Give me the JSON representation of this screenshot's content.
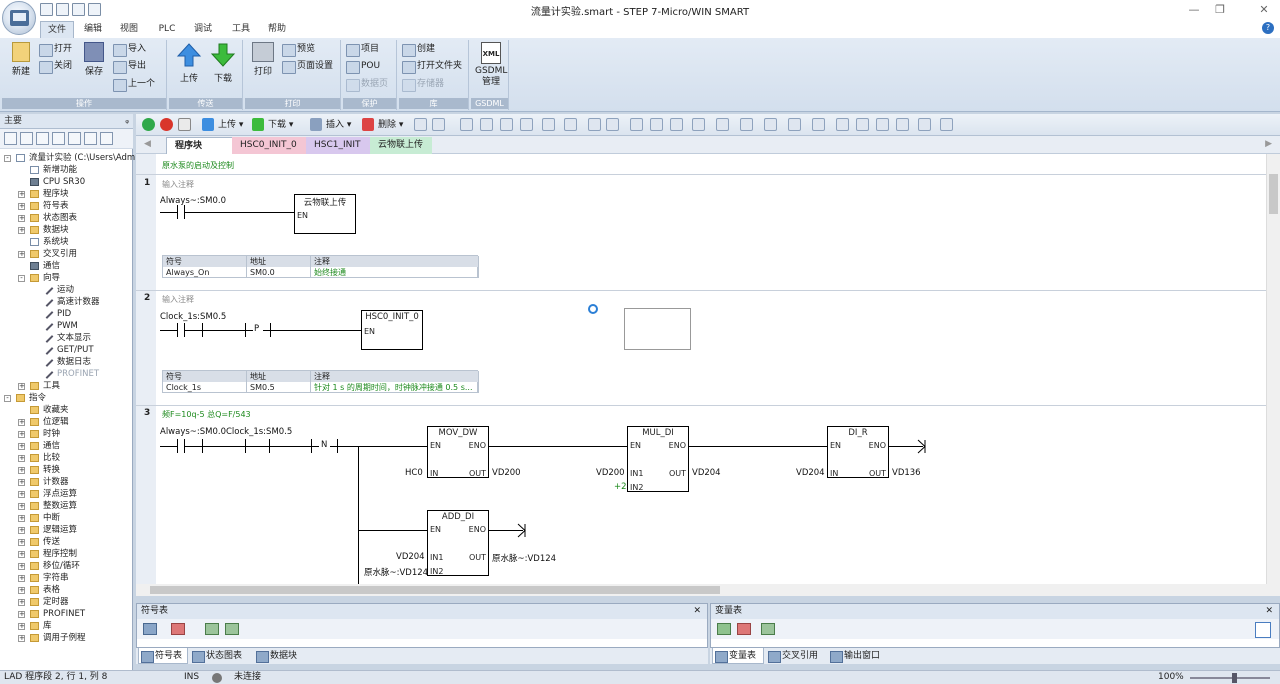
{
  "window": {
    "title": "流量计实验.smart - STEP 7-Micro/WIN SMART",
    "min": "—",
    "max": "❐",
    "close": "✕"
  },
  "ribbon_tabs": [
    "文件",
    "编辑",
    "视图",
    "PLC",
    "调试",
    "工具",
    "帮助"
  ],
  "ribbon": {
    "groups": {
      "ops": "操作",
      "transfer": "传送",
      "print": "打印",
      "protect": "保护",
      "lib": "库",
      "gsdml": "GSDML"
    },
    "new": "新建",
    "open": "打开",
    "close": "关闭",
    "save": "保存",
    "import": "导入",
    "export": "导出",
    "prev": "上一个",
    "upload": "上传",
    "download": "下载",
    "print": "打印",
    "preview": "预览",
    "page_setup": "页面设置",
    "project": "项目",
    "pou": "POU",
    "data_page": "数据页",
    "create": "创建",
    "open_folder": "打开文件夹",
    "memory": "存储器",
    "gsdml_mgmt": "GSDML\n管理",
    "xml": "XML"
  },
  "left_panel": {
    "title": "主要",
    "pin": "ᵩ",
    "tree": [
      {
        "label": "流量计实验 (C:\\Users\\Admi",
        "level": 0,
        "exp": "-",
        "icon": "page"
      },
      {
        "label": "新增功能",
        "level": 1,
        "icon": "page"
      },
      {
        "label": "CPU SR30",
        "level": 1,
        "icon": "cpu"
      },
      {
        "label": "程序块",
        "level": 1,
        "exp": "+",
        "icon": "folder"
      },
      {
        "label": "符号表",
        "level": 1,
        "exp": "+",
        "icon": "folder"
      },
      {
        "label": "状态图表",
        "level": 1,
        "exp": "+",
        "icon": "folder"
      },
      {
        "label": "数据块",
        "level": 1,
        "exp": "+",
        "icon": "folder"
      },
      {
        "label": "系统块",
        "level": 1,
        "icon": "page"
      },
      {
        "label": "交叉引用",
        "level": 1,
        "exp": "+",
        "icon": "folder"
      },
      {
        "label": "通信",
        "level": 1,
        "icon": "cpu"
      },
      {
        "label": "向导",
        "level": 1,
        "exp": "-",
        "icon": "folder"
      },
      {
        "label": "运动",
        "level": 2,
        "icon": "wand"
      },
      {
        "label": "高速计数器",
        "level": 2,
        "icon": "wand"
      },
      {
        "label": "PID",
        "level": 2,
        "icon": "wand"
      },
      {
        "label": "PWM",
        "level": 2,
        "icon": "wand"
      },
      {
        "label": "文本显示",
        "level": 2,
        "icon": "wand"
      },
      {
        "label": "GET/PUT",
        "level": 2,
        "icon": "wand"
      },
      {
        "label": "数据日志",
        "level": 2,
        "icon": "wand"
      },
      {
        "label": "PROFINET",
        "level": 2,
        "icon": "wand",
        "disabled": true
      },
      {
        "label": "工具",
        "level": 1,
        "exp": "+",
        "icon": "folder"
      },
      {
        "label": "指令",
        "level": 0,
        "exp": "-",
        "icon": "folder"
      },
      {
        "label": "收藏夹",
        "level": 1,
        "icon": "folder"
      },
      {
        "label": "位逻辑",
        "level": 1,
        "exp": "+",
        "icon": "folder"
      },
      {
        "label": "时钟",
        "level": 1,
        "exp": "+",
        "icon": "folder"
      },
      {
        "label": "通信",
        "level": 1,
        "exp": "+",
        "icon": "folder"
      },
      {
        "label": "比较",
        "level": 1,
        "exp": "+",
        "icon": "folder"
      },
      {
        "label": "转换",
        "level": 1,
        "exp": "+",
        "icon": "folder"
      },
      {
        "label": "计数器",
        "level": 1,
        "exp": "+",
        "icon": "folder"
      },
      {
        "label": "浮点运算",
        "level": 1,
        "exp": "+",
        "icon": "folder"
      },
      {
        "label": "整数运算",
        "level": 1,
        "exp": "+",
        "icon": "folder"
      },
      {
        "label": "中断",
        "level": 1,
        "exp": "+",
        "icon": "folder"
      },
      {
        "label": "逻辑运算",
        "level": 1,
        "exp": "+",
        "icon": "folder"
      },
      {
        "label": "传送",
        "level": 1,
        "exp": "+",
        "icon": "folder"
      },
      {
        "label": "程序控制",
        "level": 1,
        "exp": "+",
        "icon": "folder"
      },
      {
        "label": "移位/循环",
        "level": 1,
        "exp": "+",
        "icon": "folder"
      },
      {
        "label": "字符串",
        "level": 1,
        "exp": "+",
        "icon": "folder"
      },
      {
        "label": "表格",
        "level": 1,
        "exp": "+",
        "icon": "folder"
      },
      {
        "label": "定时器",
        "level": 1,
        "exp": "+",
        "icon": "folder"
      },
      {
        "label": "PROFINET",
        "level": 1,
        "exp": "+",
        "icon": "folder"
      },
      {
        "label": "库",
        "level": 1,
        "exp": "+",
        "icon": "folder"
      },
      {
        "label": "调用子例程",
        "level": 1,
        "exp": "+",
        "icon": "folder"
      }
    ]
  },
  "editor_toolbar": {
    "upload": "上传",
    "download": "下载",
    "insert": "插入",
    "delete": "删除"
  },
  "doc_tabs": [
    {
      "label": "程序块",
      "close": "×"
    },
    {
      "label": "HSC0_INIT_0"
    },
    {
      "label": "HSC1_INIT"
    },
    {
      "label": "云物联上传"
    }
  ],
  "program": {
    "header_comment": "原水泵的启动及控制",
    "networks": [
      {
        "num": "1",
        "comment": "输入注释",
        "contact": "Always~:SM0.0",
        "box": "云物联上传",
        "en": "EN",
        "symtab": {
          "hdr": [
            "符号",
            "地址",
            "注释"
          ],
          "row": [
            "Always_On",
            "SM0.0",
            "始终接通"
          ]
        }
      },
      {
        "num": "2",
        "comment": "输入注释",
        "contact": "Clock_1s:SM0.5",
        "p": "P",
        "box": "HSC0_INIT_0",
        "en": "EN",
        "symtab": {
          "hdr": [
            "符号",
            "地址",
            "注释"
          ],
          "row": [
            "Clock_1s",
            "SM0.5",
            "针对 1 s 的周期时间，时钟脉冲接通 0.5 s..."
          ]
        }
      },
      {
        "num": "3",
        "comment": "频F=10q-5       总Q=F/543",
        "contact1": "Always~:SM0.0",
        "contact2": "Clock_1s:SM0.5",
        "n": "N",
        "mov": {
          "title": "MOV_DW",
          "en": "EN",
          "eno": "ENO",
          "in": "IN",
          "out": "OUT",
          "in_val": "HC0",
          "out_val": "VD200"
        },
        "mul": {
          "title": "MUL_DI",
          "en": "EN",
          "eno": "ENO",
          "in1": "IN1",
          "in2": "IN2",
          "out": "OUT",
          "in1_val": "VD200",
          "in2_val": "+2",
          "out_val": "VD204"
        },
        "dir": {
          "title": "DI_R",
          "en": "EN",
          "eno": "ENO",
          "in": "IN",
          "out": "OUT",
          "in_val": "VD204",
          "out_val": "VD136"
        },
        "add": {
          "title": "ADD_DI",
          "en": "EN",
          "eno": "ENO",
          "in1": "IN1",
          "in2": "IN2",
          "out": "OUT",
          "in1_val": "VD204",
          "in2_val": "原水脉~:VD124",
          "out_val": "原水脉~:VD124"
        }
      }
    ]
  },
  "bottom_left": {
    "title": "符号表",
    "tabs": [
      "符号表",
      "状态图表",
      "数据块"
    ]
  },
  "bottom_right": {
    "title": "变量表",
    "tabs": [
      "变量表",
      "交叉引用",
      "输出窗口"
    ]
  },
  "status": {
    "pos": "LAD 程序段 2, 行 1, 列 8",
    "mode": "INS",
    "conn": "未连接",
    "zoom": "100%"
  }
}
